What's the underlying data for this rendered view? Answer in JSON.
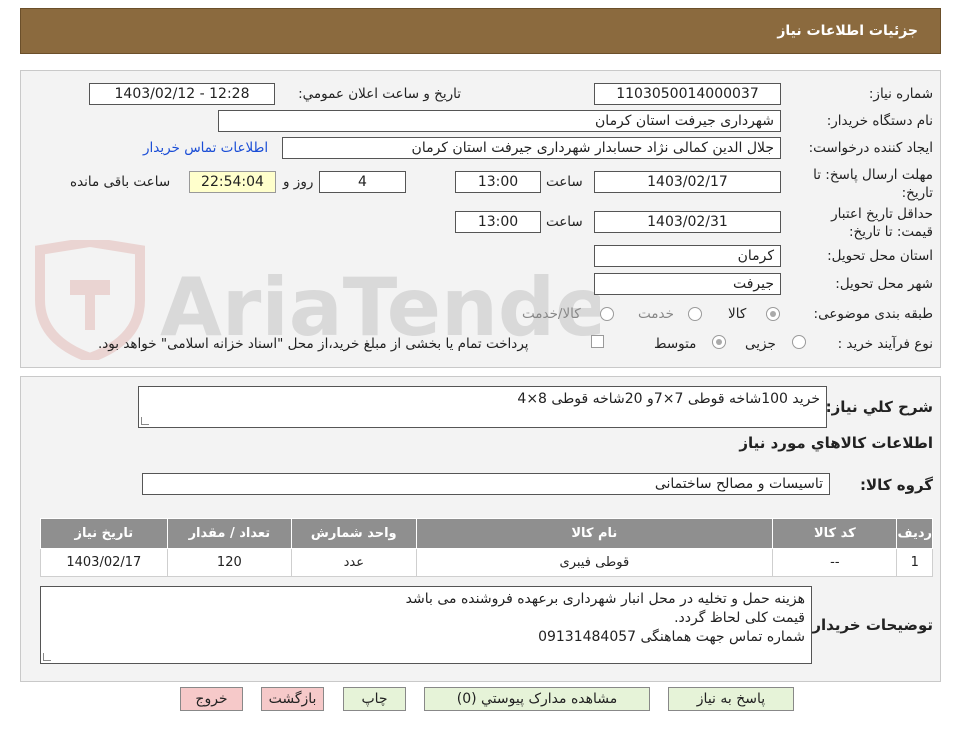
{
  "header": {
    "title": "جزئیات اطلاعات نیاز"
  },
  "fields": {
    "need_number_label": "شماره نیاز:",
    "need_number": "1103050014000037",
    "announce_label": "تاریخ و ساعت اعلان عمومي:",
    "announce_value": "1403/02/12 - 12:28",
    "buyer_org_label": "نام دستگاه خریدار:",
    "buyer_org": "شهرداری جیرفت استان کرمان",
    "creator_label": "ایجاد کننده درخواست:",
    "creator": "جلال الدین کمالی نژاد حسابدار شهرداری جیرفت استان کرمان",
    "contact_link": "اطلاعات تماس خریدار",
    "reply_deadline_label": "مهلت ارسال پاسخ: تا تاریخ:",
    "reply_date": "1403/02/17",
    "time_label": "ساعت",
    "reply_time": "13:00",
    "days": "4",
    "days_label": "روز و",
    "remaining_time": "22:54:04",
    "remaining_label": "ساعت باقی مانده",
    "validity_label": "حداقل تاریخ اعتبار قیمت: تا تاریخ:",
    "validity_date": "1403/02/31",
    "validity_time": "13:00",
    "province_label": "استان محل تحویل:",
    "province": "کرمان",
    "city_label": "شهر محل تحویل:",
    "city": "جیرفت",
    "category_label": "طبقه بندی موضوعی:",
    "category_options": [
      "کالا",
      "خدمت",
      "کالا/خدمت"
    ],
    "process_label": "نوع فرآیند خرید :",
    "process_options": [
      "جزیی",
      "متوسط"
    ],
    "treasury_note": "پرداخت تمام یا بخشی از مبلغ خرید،از محل \"اسناد خزانه اسلامی\" خواهد بود."
  },
  "summary": {
    "label": "شرح کلي نياز:",
    "text": "خرید 100شاخه قوطی 7×7و 20شاخه قوطی 8×4"
  },
  "goods_section": {
    "title": "اطلاعات کالاهاي مورد نياز",
    "group_label": "گروه کالا:",
    "group_value": "تاسیسات و مصالح ساختمانی"
  },
  "table": {
    "headers": [
      "رديف",
      "کد کالا",
      "نام کالا",
      "واحد شمارش",
      "تعداد / مقدار",
      "تاريخ نياز"
    ],
    "rows": [
      [
        "1",
        "--",
        "قوطی فیبری",
        "عدد",
        "120",
        "1403/02/17"
      ]
    ]
  },
  "buyer_notes": {
    "label": "توضیحات خریدار:",
    "lines": [
      "هزینه حمل  و تخلیه در محل انبار شهرداری برعهده فروشنده می باشد",
      "قیمت کلی لحاظ گردد.",
      "شماره تماس جهت هماهنگی 09131484057"
    ]
  },
  "buttons": {
    "reply": "پاسخ به نياز",
    "attachments": "مشاهده مدارک پيوستي (0)",
    "print": "چاپ",
    "back": "بازگشت",
    "exit": "خروج"
  },
  "colors": {
    "header": "#8b6a3e",
    "table_header": "#8f8f8f",
    "green_button": "#e6f3d8",
    "red_button": "#f6c9c9"
  }
}
